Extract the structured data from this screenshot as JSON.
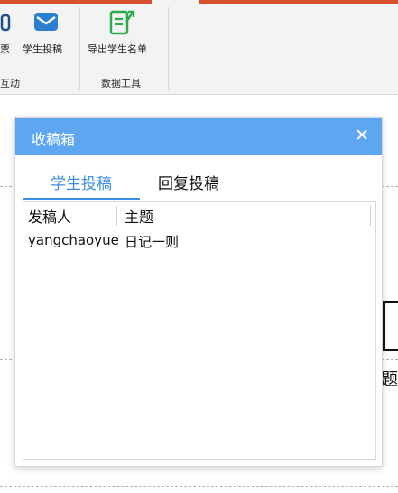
{
  "ribbon": {
    "items": [
      {
        "label": "票",
        "icon": "vote-icon"
      },
      {
        "label": "学生投稿",
        "icon": "envelope-icon"
      },
      {
        "label": "导出学生名单",
        "icon": "export-icon"
      }
    ],
    "groups": [
      {
        "label": "互动"
      },
      {
        "label": "数据工具"
      }
    ],
    "accent_color": "#d4532e"
  },
  "dialog": {
    "title": "收稿箱",
    "close_glyph": "✕",
    "header_color": "#5ea7f0",
    "tabs": [
      {
        "label": "学生投稿",
        "active": true
      },
      {
        "label": "回复投稿",
        "active": false
      }
    ],
    "list": {
      "columns": [
        "发稿人",
        "主题"
      ],
      "rows": [
        [
          "yangchaoyue",
          "日记一则"
        ]
      ]
    }
  },
  "background": {
    "partial_text": "题"
  }
}
